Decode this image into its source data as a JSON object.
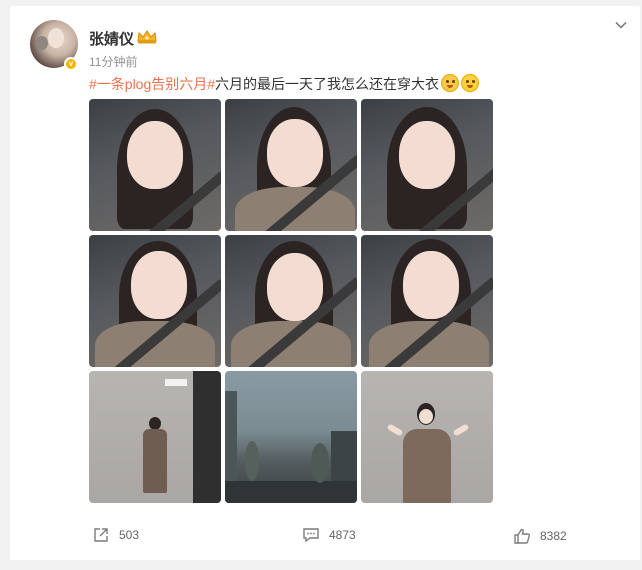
{
  "post": {
    "username": "张婧仪",
    "time": "11分钟前",
    "hashtag": "#一条plog告别六月#",
    "text": "六月的最后一天了我怎么还在穿大衣",
    "verified_badge": "v"
  },
  "photos": [
    {
      "kind": "car-selfie"
    },
    {
      "kind": "car-peace"
    },
    {
      "kind": "car-selfie"
    },
    {
      "kind": "car-peace"
    },
    {
      "kind": "car-peace"
    },
    {
      "kind": "car-peace"
    },
    {
      "kind": "wall-standing"
    },
    {
      "kind": "street-view"
    },
    {
      "kind": "wall-peace"
    }
  ],
  "actions": {
    "share_count": "503",
    "comment_count": "4873",
    "like_count": "8382"
  },
  "icons": {
    "share": "share-icon",
    "comment": "comment-icon",
    "like": "like-icon",
    "menu": "chevron-down-icon",
    "badge": "crown-icon"
  },
  "colors": {
    "hashtag": "#eb7350",
    "background": "#f2f2f2",
    "verified": "#f7b500"
  }
}
